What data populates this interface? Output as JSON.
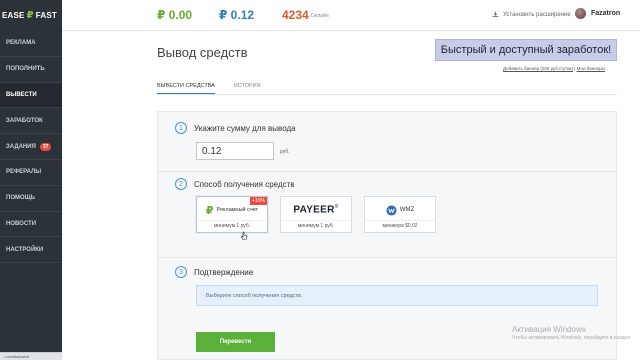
{
  "header": {
    "logo_left": "EASE",
    "logo_symbol": "₽",
    "logo_right": "FAST",
    "balance_main": "₽ 0.00",
    "balance_ad": "₽ 0.12",
    "online_count": "4234",
    "online_label": "Онлайн",
    "install_extension": "Установить расширение",
    "username": "Fazatron",
    "icons": [
      "download-icon"
    ]
  },
  "sidebar": {
    "items": [
      {
        "label": "Реклама"
      },
      {
        "label": "Пополнить"
      },
      {
        "label": "Вывести"
      },
      {
        "label": "Заработок"
      },
      {
        "label": "Задания",
        "badge": "37"
      },
      {
        "label": "Рефералы"
      },
      {
        "label": "Помощь"
      },
      {
        "label": "Новости"
      },
      {
        "label": "Настройки"
      }
    ],
    "active_index": 2
  },
  "status_bar": {
    "url": "...ru/withdraw/#"
  },
  "main": {
    "title": "Вывод средств",
    "banner": {
      "text": "Быстрый и доступный заработок!",
      "link_add": "Добавить баннер (200 руб./сутки)",
      "link_my": "Мои баннеры"
    },
    "tabs": [
      {
        "label": "Вывести средства",
        "active": true
      },
      {
        "label": "История",
        "active": false
      }
    ]
  },
  "form": {
    "step1": {
      "number": "1",
      "title": "Укажите сумму для вывода",
      "amount": "0.12",
      "unit": "руб."
    },
    "step2": {
      "number": "2",
      "title": "Способ получения средств",
      "methods": [
        {
          "name": "Рекламный счет",
          "logo_symbol": "₽",
          "promo": "+10%",
          "min": "минимум 1 руб.",
          "selected": true
        },
        {
          "name": "PAYEER",
          "trademark": "®",
          "min": "минимум 1 руб."
        },
        {
          "name": "WMZ",
          "min": "минимум $0.02"
        }
      ]
    },
    "step3": {
      "number": "3",
      "title": "Подтверждение",
      "info": "Выберите способ получения средств.",
      "submit": "Перевести"
    }
  },
  "watermark": {
    "line1": "Активация Windows",
    "line2": "Чтобы активировать Windows, перейдите в раздел"
  },
  "colors": {
    "accent_green": "#5cb13a",
    "accent_blue": "#2f7fbf",
    "sidebar_bg": "#2c3338",
    "badge_red": "#e84c3d",
    "online_orange": "#e2572d"
  }
}
